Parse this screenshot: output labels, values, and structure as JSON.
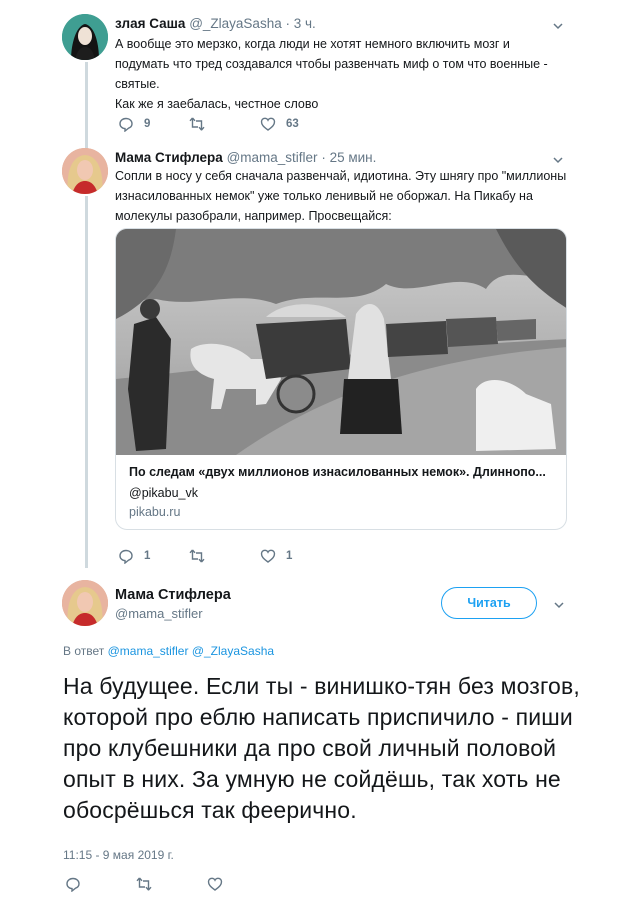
{
  "tweet1": {
    "name": "злая Саша",
    "handle": "@_ZlayaSasha",
    "time": "3 ч.",
    "lines": [
      "А вообще это мерзко, когда люди не хотят немного включить мозг и",
      "подумать что тред создавался чтобы развенчать миф о том что военные -",
      "святые.",
      "Как же я заебалась, честное слово"
    ],
    "replies": "9",
    "retweets": "",
    "likes": "63"
  },
  "tweet2": {
    "name": "Мама Стифлера",
    "handle": "@mama_stifler",
    "time": "25 мин.",
    "lines": [
      "Сопли в носу у себя сначала развенчай, идиотина. Эту шнягу про \"миллионы",
      "изнасилованных немок\" уже только ленивый не оборжал. На Пикабу на",
      "молекулы разобрали, например. Просвещайся:"
    ],
    "card": {
      "title": "По следам «двух миллионов изнасилованных немок». Длиннопо...",
      "handle": "@pikabu_vk",
      "domain": "pikabu.ru"
    },
    "replies": "1",
    "retweets": "",
    "likes": "1"
  },
  "main_tweet": {
    "name": "Мама Стифлера",
    "handle": "@mama_stifler",
    "follow_label": "Читать",
    "reply_prefix": "В ответ",
    "reply_to_1": "@mama_stifler",
    "reply_to_2": "@_ZlayaSasha",
    "text": "На будущее. Если ты - винишко-тян без мозгов, которой про еблю написать приспичило - пиши про клубешники да про свой личный половой опыт в них. За умную не сойдёшь, так хоть не обосрёшься так феерично.",
    "timestamp": "11:15 - 9 мая 2019 г."
  },
  "colors": {
    "accent": "#1da1f2",
    "link": "#1b95e0",
    "muted": "#657786",
    "thread_line": "#cfd9de"
  }
}
